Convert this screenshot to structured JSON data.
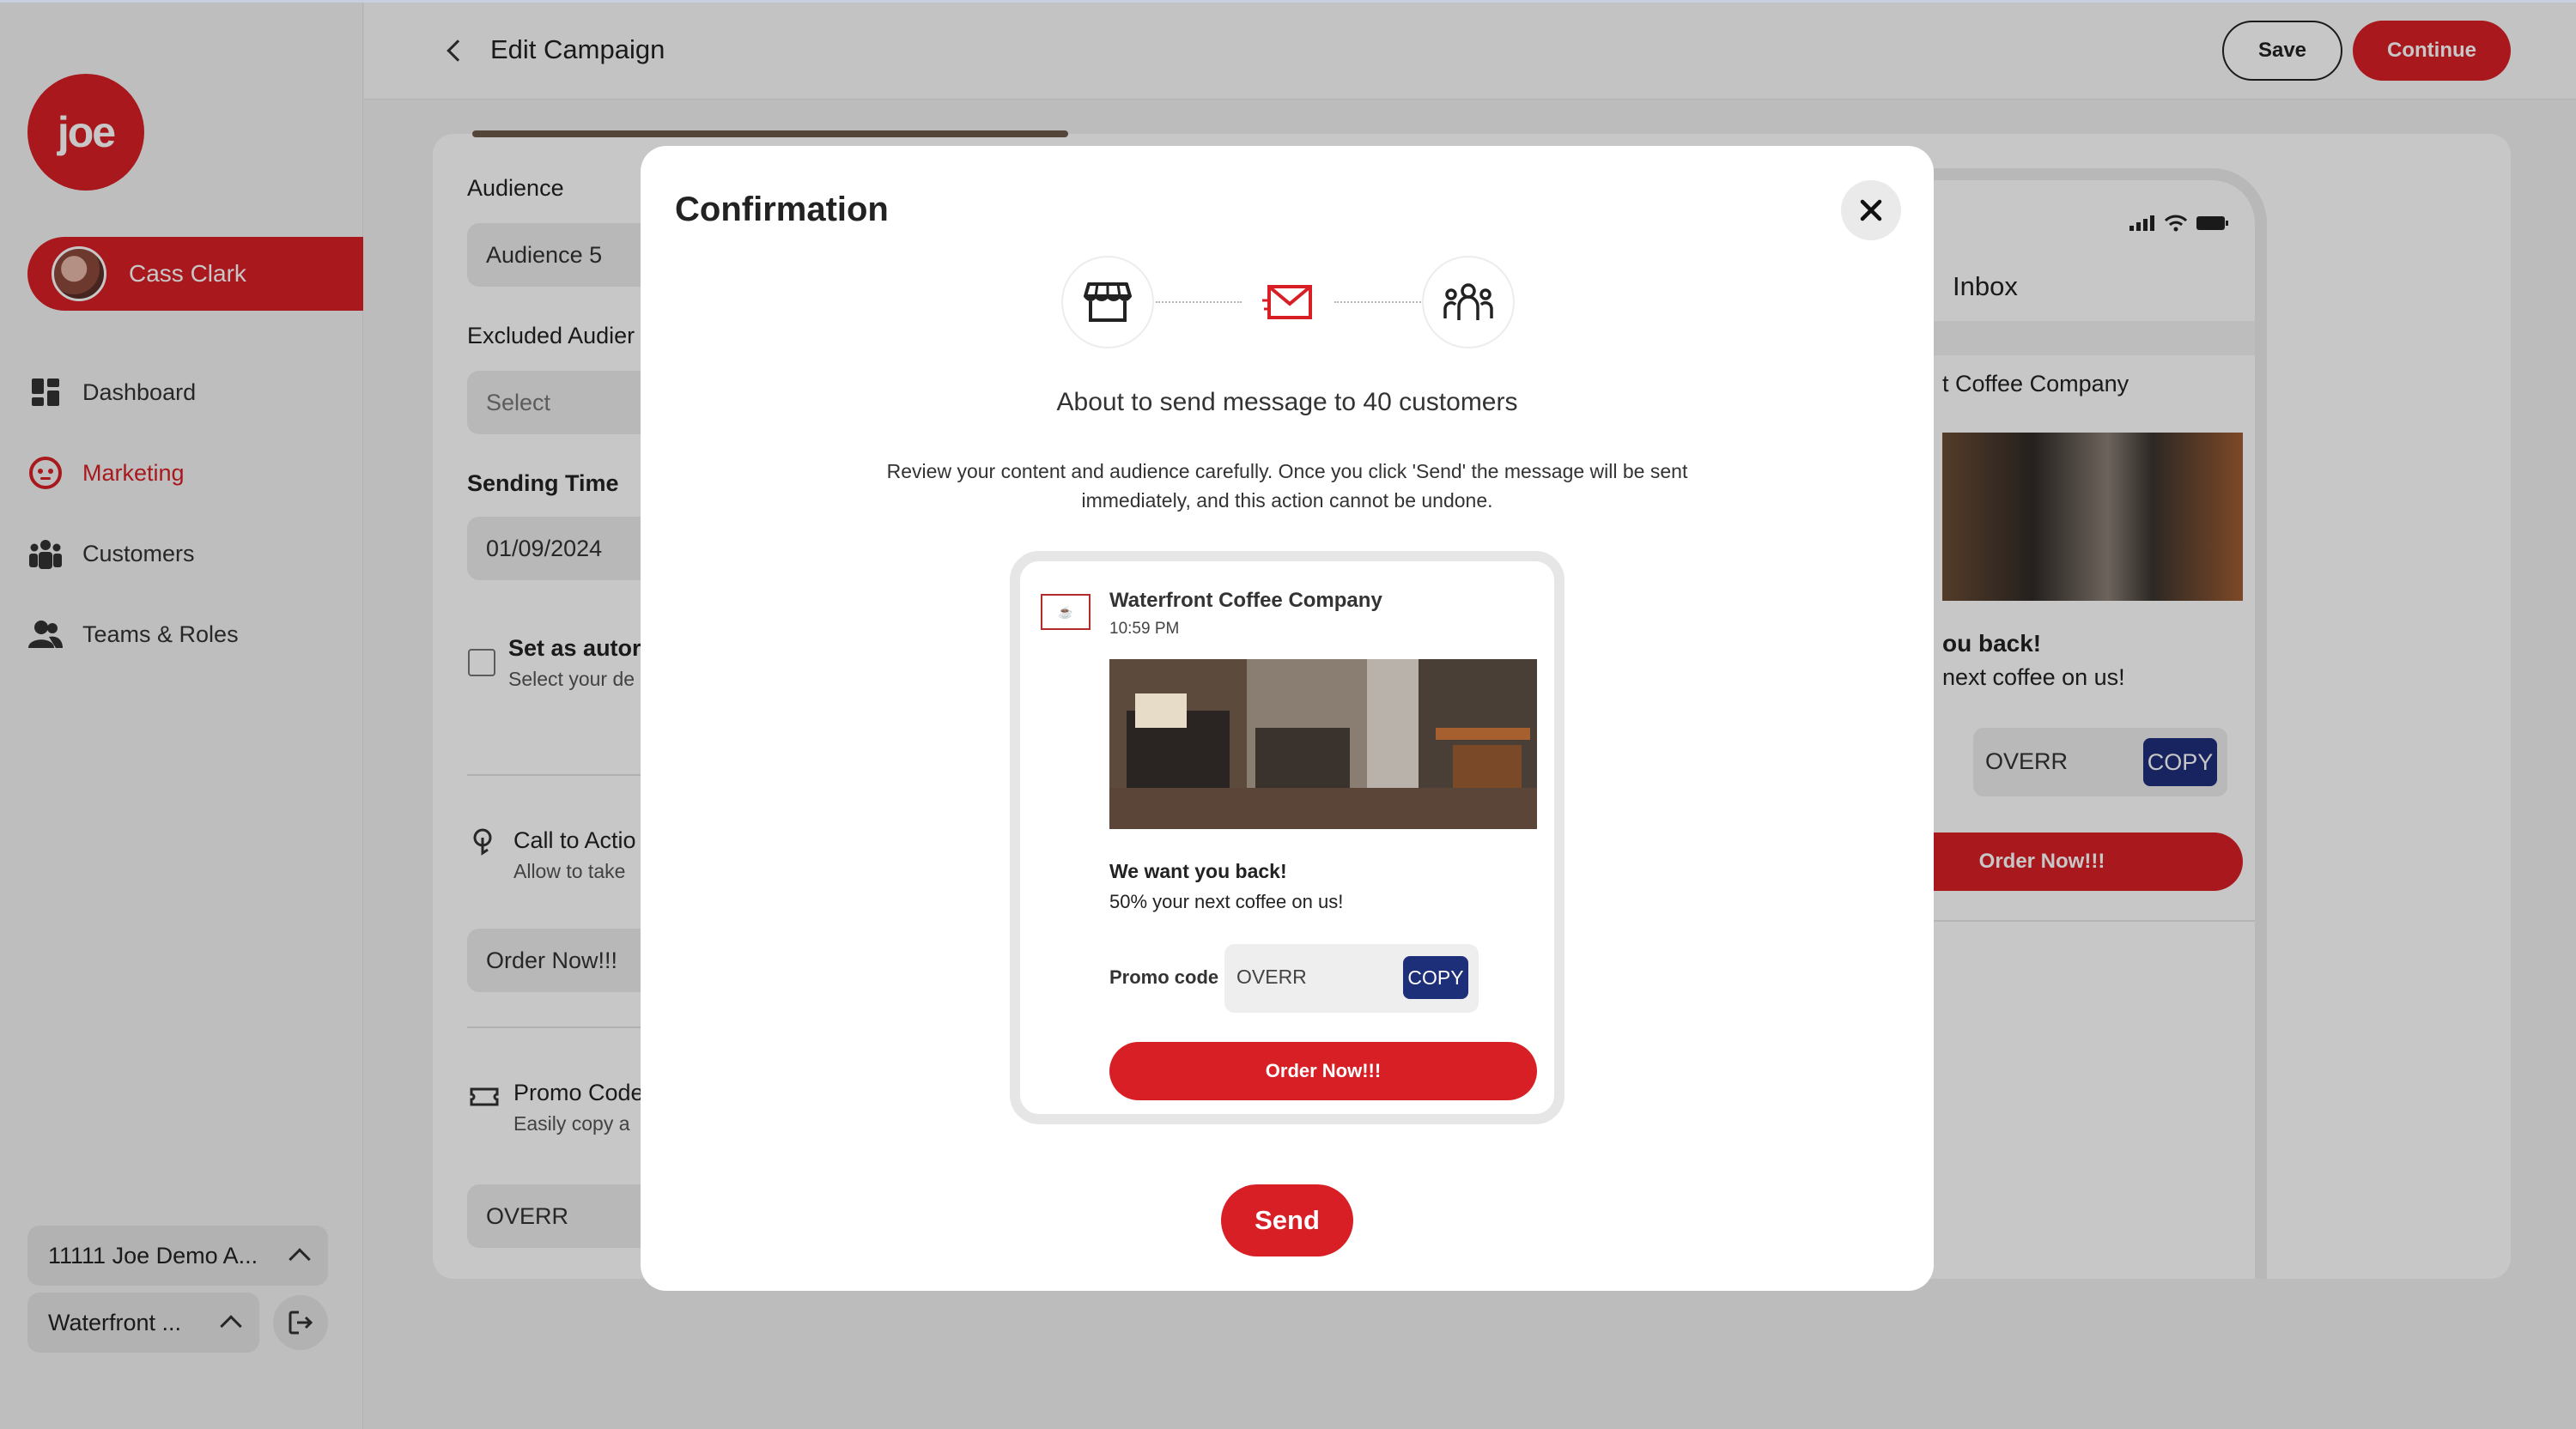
{
  "app": {
    "logo_text": "joe"
  },
  "sidebar": {
    "user_name": "Cass Clark",
    "items": [
      {
        "label": "Dashboard",
        "icon": "dashboard-icon",
        "active": false
      },
      {
        "label": "Marketing",
        "icon": "marketing-icon",
        "active": true
      },
      {
        "label": "Customers",
        "icon": "customers-icon",
        "active": false
      },
      {
        "label": "Teams & Roles",
        "icon": "teams-icon",
        "active": false
      }
    ],
    "account_selector": "11111 Joe Demo A...",
    "store_selector": "Waterfront ..."
  },
  "header": {
    "title": "Edit Campaign",
    "save_label": "Save",
    "continue_label": "Continue"
  },
  "form": {
    "audience_label": "Audience",
    "audience_value": "Audience 5",
    "excluded_label": "Excluded Audier",
    "excluded_placeholder": "Select",
    "sending_time_label": "Sending Time",
    "sending_time_value": "01/09/2024",
    "auto_label": "Set as autor",
    "auto_sub": "Select your de",
    "cta_label": "Call to Actio",
    "cta_sub": "Allow to take",
    "cta_value": "Order Now!!!",
    "promo_label": "Promo Code",
    "promo_sub": "Easily copy a",
    "promo_value": "OVERR"
  },
  "phone_preview": {
    "inbox_label": "Inbox",
    "company": "t Coffee Company",
    "headline": "ou back!",
    "subline": "next coffee on us!",
    "promo_code": "OVERR",
    "copy_label": "COPY",
    "order_label": "Order Now!!!"
  },
  "modal": {
    "title": "Confirmation",
    "heading": "About to send message to 40 customers",
    "description": "Review your content and audience carefully. Once you click 'Send' the message will be sent immediately, and this action cannot be undone.",
    "preview": {
      "company": "Waterfront Coffee Company",
      "time": "10:59 PM",
      "headline": "We want you back!",
      "subline": "50% your next coffee on us!",
      "promo_label": "Promo code",
      "promo_code": "OVERR",
      "copy_label": "COPY",
      "order_label": "Order Now!!!"
    },
    "send_label": "Send"
  },
  "colors": {
    "brand_red": "#d81f26",
    "copy_blue": "#1e2f7a"
  }
}
